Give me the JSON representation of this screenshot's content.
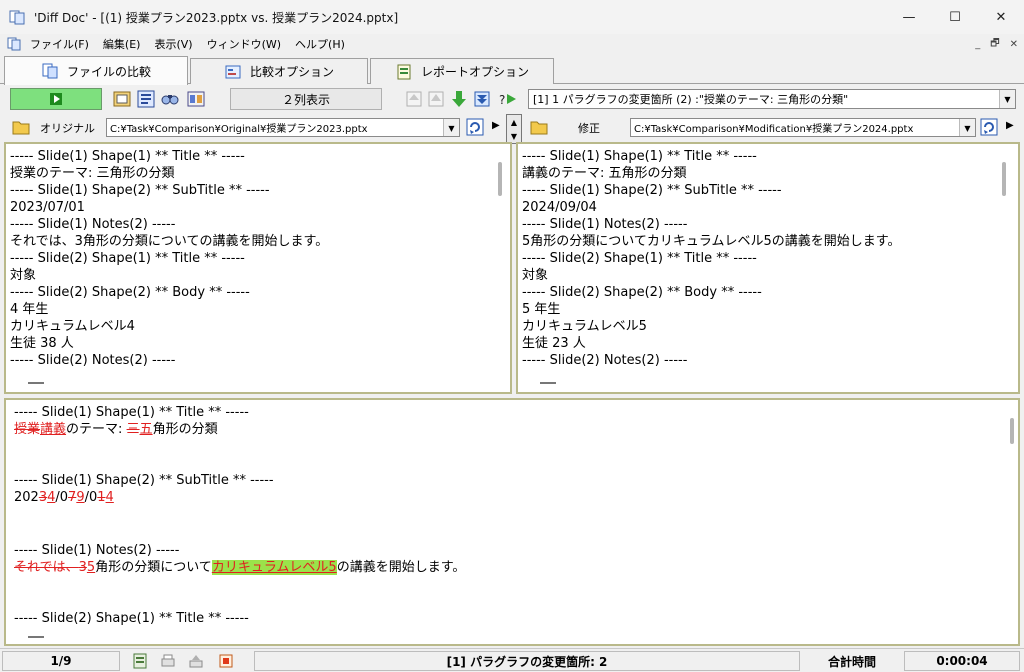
{
  "window": {
    "title": "'Diff Doc' - [(1) 授業プラン2023.pptx vs. 授業プラン2024.pptx]",
    "minimize": "—",
    "maximize": "☐",
    "close": "✕"
  },
  "menu": {
    "items": [
      "ファイル(F)",
      "編集(E)",
      "表示(V)",
      "ウィンドウ(W)",
      "ヘルプ(H)"
    ],
    "mdi": [
      "_",
      "🗗",
      "✕"
    ]
  },
  "tabs": [
    {
      "label": "ファイルの比較",
      "icon": "file-compare-icon"
    },
    {
      "label": "比較オプション",
      "icon": "compare-options-icon"
    },
    {
      "label": "レポートオプション",
      "icon": "report-options-icon"
    }
  ],
  "toolbar": {
    "view_mode": "２列表示",
    "diff_selector": "[1] 1 パラグラフの変更箇所 (2) :\"授業のテーマ: 三角形の分類\""
  },
  "original": {
    "label": "オリジナル",
    "path": "C:¥Task¥Comparison¥Original¥授業プラン2023.pptx",
    "lines": [
      "----- Slide(1) Shape(1) ** Title ** -----",
      "授業のテーマ: 三角形の分類",
      "----- Slide(1) Shape(2) ** SubTitle ** -----",
      "2023/07/01",
      "----- Slide(1) Notes(2) -----",
      "それでは、3角形の分類についての講義を開始します。",
      "----- Slide(2) Shape(1) ** Title ** -----",
      "対象",
      "----- Slide(2) Shape(2) ** Body ** -----",
      "4 年生",
      "カリキュラムレベル4",
      "生徒 38 人",
      "----- Slide(2) Notes(2) -----"
    ]
  },
  "modified": {
    "label": "修正",
    "path": "C:¥Task¥Comparison¥Modification¥授業プラン2024.pptx",
    "lines": [
      "----- Slide(1) Shape(1) ** Title ** -----",
      "講義のテーマ: 五角形の分類",
      "----- Slide(1) Shape(2) ** SubTitle ** -----",
      "2024/09/04",
      "----- Slide(1) Notes(2) -----",
      "5角形の分類についてカリキュラムレベル5の講義を開始します。",
      "----- Slide(2) Shape(1) ** Title ** -----",
      "対象",
      "----- Slide(2) Shape(2) ** Body ** -----",
      "5 年生",
      "カリキュラムレベル5",
      "生徒 23 人",
      "----- Slide(2) Notes(2) -----"
    ]
  },
  "diff": {
    "h1": "----- Slide(1) Shape(1) ** Title ** -----",
    "l1": [
      {
        "t": "授業",
        "k": "del"
      },
      {
        "t": "講義",
        "k": "ins"
      },
      {
        "t": "のテーマ: ",
        "k": "n"
      },
      {
        "t": "三",
        "k": "del"
      },
      {
        "t": "五",
        "k": "ins"
      },
      {
        "t": "角形の分類",
        "k": "n"
      }
    ],
    "h2": "----- Slide(1) Shape(2) ** SubTitle ** -----",
    "l2": [
      {
        "t": "202",
        "k": "n"
      },
      {
        "t": "3",
        "k": "del"
      },
      {
        "t": "4",
        "k": "ins"
      },
      {
        "t": "/0",
        "k": "n"
      },
      {
        "t": "7",
        "k": "del"
      },
      {
        "t": "9",
        "k": "ins"
      },
      {
        "t": "/0",
        "k": "n"
      },
      {
        "t": "1",
        "k": "del"
      },
      {
        "t": "4",
        "k": "ins"
      }
    ],
    "h3": "----- Slide(1) Notes(2) -----",
    "l3": [
      {
        "t": "それでは、",
        "k": "del"
      },
      {
        "t": "3",
        "k": "del"
      },
      {
        "t": "5",
        "k": "ins"
      },
      {
        "t": "角形の分類について",
        "k": "n"
      },
      {
        "t": "カリキュラムレベル5",
        "k": "hl"
      },
      {
        "t": "の講義を開始します。",
        "k": "n"
      }
    ],
    "h4": "----- Slide(2) Shape(1) ** Title ** -----"
  },
  "status": {
    "page": "1/9",
    "message": "[1] パラグラフの変更箇所: 2",
    "time_label": "合計時間",
    "time": "0:00:04"
  },
  "colors": {
    "pane_border": "#b9b98a",
    "diff_red": "#e02020",
    "highlight": "#9be34a",
    "go_button": "#7ee07e"
  }
}
